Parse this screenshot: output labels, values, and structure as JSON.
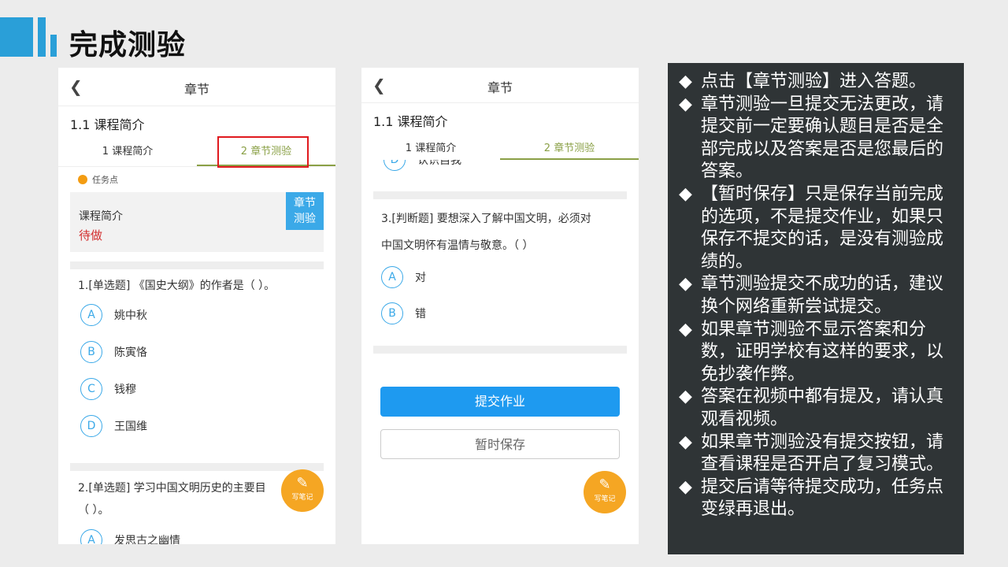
{
  "slide_title": "完成测验",
  "phone1": {
    "nav_title": "章节",
    "course_title": "1.1 课程简介",
    "tabs": [
      "1 课程简介",
      "2 章节测验"
    ],
    "task_point": "任务点",
    "task_card": {
      "label": "课程简介",
      "status": "待做",
      "badge_line1": "章节",
      "badge_line2": "测验"
    },
    "question1": "1.[单选题] 《国史大纲》的作者是（ ）。",
    "q1_options": [
      {
        "letter": "A",
        "text": "姚中秋"
      },
      {
        "letter": "B",
        "text": "陈寅恪"
      },
      {
        "letter": "C",
        "text": "钱穆"
      },
      {
        "letter": "D",
        "text": "王国维"
      }
    ],
    "question2_line1": "2.[单选题] 学习中国文明历史的主要目",
    "question2_line2": "（ ）。",
    "q2_option_a": {
      "letter": "A",
      "text": "发思古之幽情"
    },
    "note_button": "写笔记"
  },
  "phone2": {
    "nav_title": "章节",
    "course_title": "1.1 课程简介",
    "tabs": [
      "1 课程简介",
      "2 章节测验"
    ],
    "cut_option": {
      "letter": "D",
      "text": "认识自我"
    },
    "question3_line1": "3.[判断题] 要想深入了解中国文明，必须对",
    "question3_line2": "中国文明怀有温情与敬意。（ ）",
    "q3_options": [
      {
        "letter": "A",
        "text": "对"
      },
      {
        "letter": "B",
        "text": "错"
      }
    ],
    "submit_button": "提交作业",
    "save_button": "暂时保存",
    "note_button": "写笔记"
  },
  "panel": {
    "marker": "◆",
    "bullets": [
      "点击【章节测验】进入答题。",
      "章节测验一旦提交无法更改，请提交前一定要确认题目是否是全部完成以及答案是否是您最后的答案。",
      "【暂时保存】只是保存当前完成的选项，不是提交作业，如果只保存不提交的话，是没有测验成绩的。",
      "章节测验提交不成功的话，建议换个网络重新尝试提交。",
      "如果章节测验不显示答案和分数，证明学校有这样的要求，以免抄袭作弊。",
      "答案在视频中都有提及，请认真观看视频。",
      "如果章节测验没有提交按钮，请查看课程是否开启了复习模式。",
      "提交后请等待提交成功，任务点变绿再退出。"
    ]
  },
  "colors": {
    "accent": "#2a9fd8",
    "tab_active": "#8aa046",
    "highlight_box": "#e0191e",
    "submit": "#1e9af0",
    "panel_bg": "#2f3436"
  }
}
